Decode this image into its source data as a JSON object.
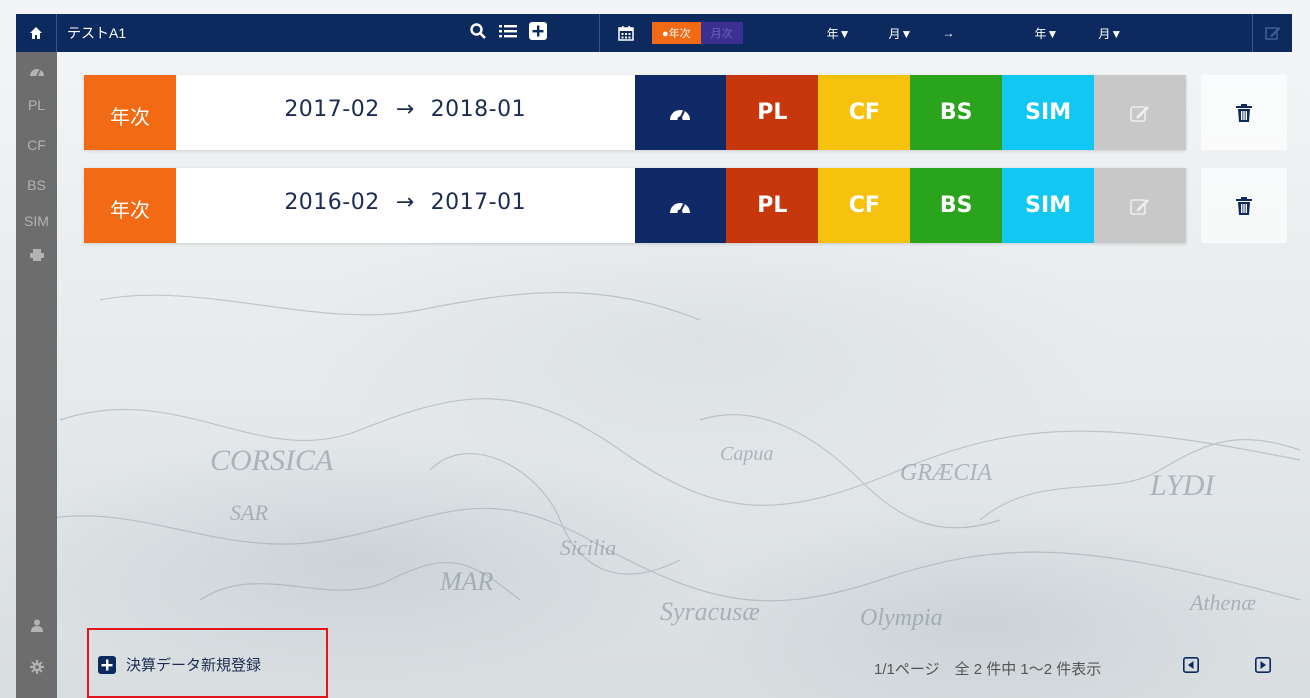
{
  "header": {
    "title": "テストA1",
    "mode_annual": "●年次",
    "mode_monthly": "月次",
    "from_year": "年▼",
    "from_month": "月▼",
    "range_arrow": "→",
    "to_year": "年▼",
    "to_month": "月▼",
    "icons": [
      "home-icon",
      "search-icon",
      "list-icon",
      "plus-square-icon",
      "calendar-icon",
      "edit-icon"
    ]
  },
  "sidebar": {
    "items": [
      {
        "label": "",
        "icon": "dashboard-icon"
      },
      {
        "label": "PL"
      },
      {
        "label": "CF"
      },
      {
        "label": "BS"
      },
      {
        "label": "SIM"
      },
      {
        "label": "",
        "icon": "print-icon"
      }
    ],
    "bottom_icons": [
      "user-icon",
      "gear-icon"
    ]
  },
  "rows": [
    {
      "type": "年次",
      "start": "2017-02",
      "arrow": "→",
      "end": "2018-01",
      "pl": "PL",
      "cf": "CF",
      "bs": "BS",
      "sim": "SIM"
    },
    {
      "type": "年次",
      "start": "2016-02",
      "arrow": "→",
      "end": "2017-01",
      "pl": "PL",
      "cf": "CF",
      "bs": "BS",
      "sim": "SIM"
    }
  ],
  "footer": {
    "new_registration": "決算データ新規登録",
    "pager_text": "1/1ページ　全 2 件中 1〜2 件表示"
  },
  "colors": {
    "navy": "#0d2a5e",
    "orange": "#f26a13",
    "pl_red": "#c8360b",
    "cf_yellow": "#f7c20e",
    "bs_green": "#2ba41d",
    "sim_cyan": "#12c8f2",
    "highlight_red": "#e0151d"
  }
}
